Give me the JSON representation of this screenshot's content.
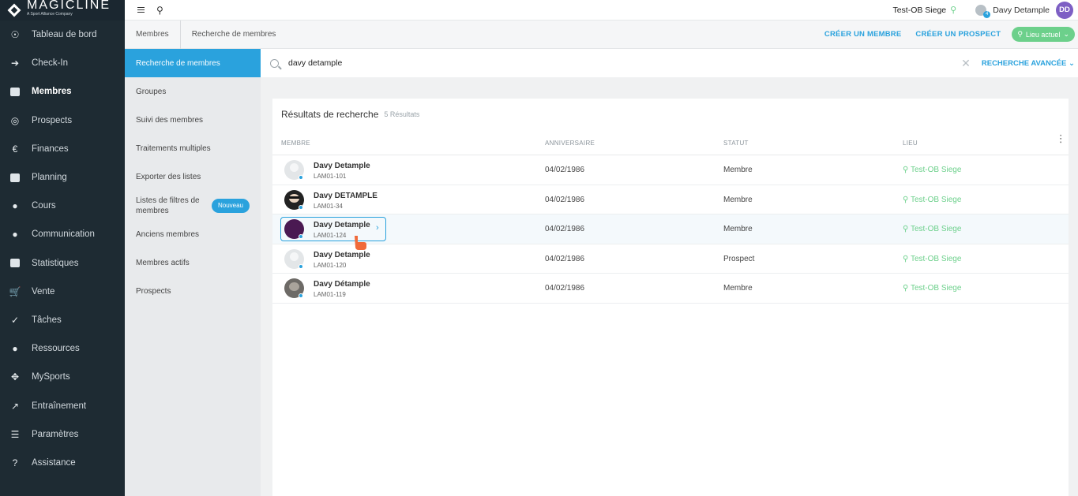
{
  "brand": {
    "name": "MAGICLINE",
    "sub": "A Sport Alliance Company"
  },
  "nav": {
    "items": [
      {
        "label": "Tableau de bord",
        "icon": "dashboard-icon"
      },
      {
        "label": "Check-In",
        "icon": "checkin-icon"
      },
      {
        "label": "Membres",
        "icon": "members-icon",
        "active": true
      },
      {
        "label": "Prospects",
        "icon": "prospects-icon"
      },
      {
        "label": "Finances",
        "icon": "finances-icon"
      },
      {
        "label": "Planning",
        "icon": "calendar-icon"
      },
      {
        "label": "Cours",
        "icon": "courses-icon"
      },
      {
        "label": "Communication",
        "icon": "chat-icon"
      },
      {
        "label": "Statistiques",
        "icon": "chart-icon"
      },
      {
        "label": "Vente",
        "icon": "cart-icon"
      },
      {
        "label": "Tâches",
        "icon": "task-check-icon"
      },
      {
        "label": "Ressources",
        "icon": "resources-icon"
      },
      {
        "label": "MySports",
        "icon": "mysports-icon"
      },
      {
        "label": "Entraînement",
        "icon": "training-icon"
      },
      {
        "label": "Paramètres",
        "icon": "settings-sliders-icon"
      },
      {
        "label": "Assistance",
        "icon": "help-icon"
      }
    ]
  },
  "topbar": {
    "location": "Test-OB Siege",
    "user_badge": "4",
    "user_name": "Davy Detample",
    "user_initials": "DD"
  },
  "breadcrumb": {
    "level1": "Membres",
    "level2": "Recherche de membres"
  },
  "actions": {
    "create_member": "CRÉER UN MEMBRE",
    "create_prospect": "CRÉER UN PROSPECT",
    "current_location": "Lieu actuel"
  },
  "subnav": {
    "items": [
      {
        "label": "Recherche de membres",
        "active": true
      },
      {
        "label": "Groupes"
      },
      {
        "label": "Suivi des membres"
      },
      {
        "label": "Traitements multiples"
      },
      {
        "label": "Exporter des listes"
      },
      {
        "label": "Listes de filtres de membres",
        "badge": "Nouveau"
      },
      {
        "label": "Anciens membres"
      },
      {
        "label": "Membres actifs"
      },
      {
        "label": "Prospects"
      }
    ]
  },
  "search": {
    "value": "davy detample",
    "advanced": "RECHERCHE AVANCÉE"
  },
  "results": {
    "title": "Résultats de recherche",
    "count": "5 Résultats",
    "columns": [
      "MEMBRE",
      "ANNIVERSAIRE",
      "STATUT",
      "LIEU"
    ],
    "rows": [
      {
        "name": "Davy Detample",
        "id": "LAM01-101",
        "birthday": "04/02/1986",
        "status": "Membre",
        "location": "Test-OB Siege",
        "avatar": "default"
      },
      {
        "name": "Davy DETAMPLE",
        "id": "LAM01-34",
        "birthday": "04/02/1986",
        "status": "Membre",
        "location": "Test-OB Siege",
        "avatar": "dark"
      },
      {
        "name": "Davy Detample",
        "id": "LAM01-124",
        "birthday": "04/02/1986",
        "status": "Membre",
        "location": "Test-OB Siege",
        "avatar": "purple",
        "highlighted": true
      },
      {
        "name": "Davy Detample",
        "id": "LAM01-120",
        "birthday": "04/02/1986",
        "status": "Prospect",
        "location": "Test-OB Siege",
        "avatar": "default"
      },
      {
        "name": "Davy Détample",
        "id": "LAM01-119",
        "birthday": "04/02/1986",
        "status": "Membre",
        "location": "Test-OB Siege",
        "avatar": "gray"
      }
    ]
  },
  "colors": {
    "accent": "#2aa2dd",
    "success": "#6cd08b",
    "nav_bg": "#1e2b33",
    "user_avatar": "#7d5fc4"
  }
}
